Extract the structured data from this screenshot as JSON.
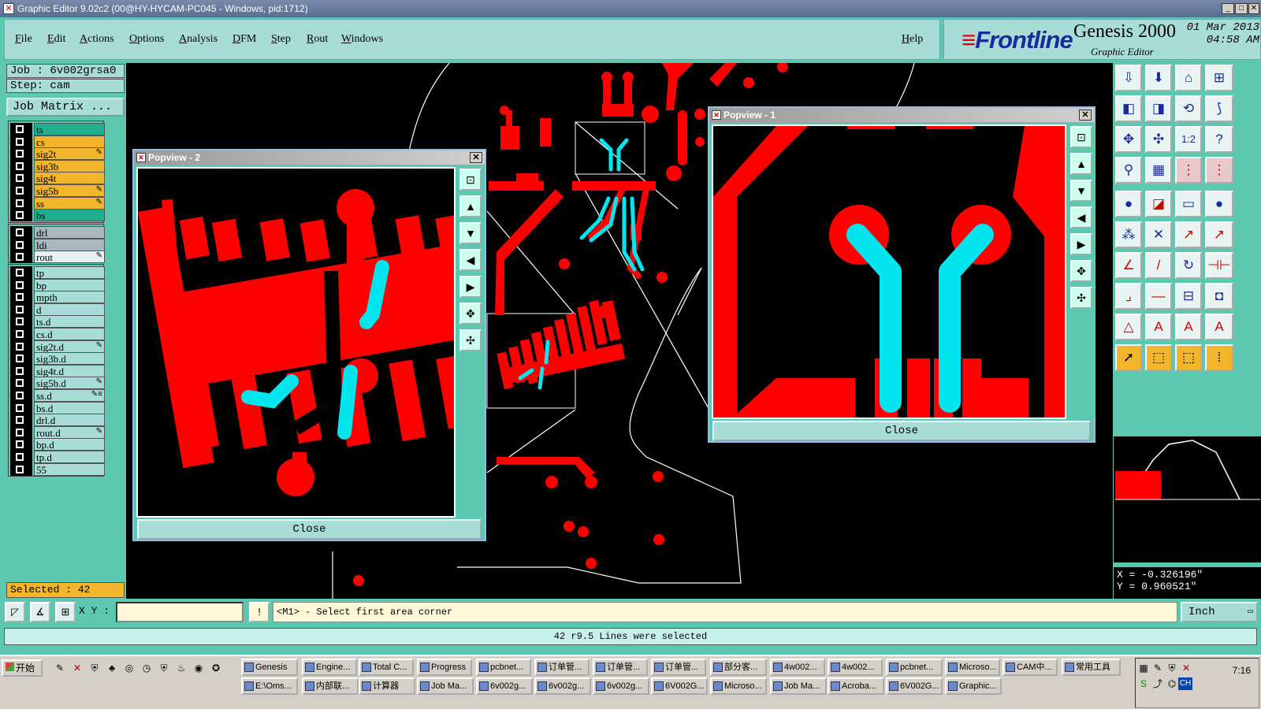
{
  "window": {
    "title": "Graphic Editor 9.02c2 (00@HY-HYCAM-PC045 - Windows, pid:1712)"
  },
  "menu": {
    "items": [
      "File",
      "Edit",
      "Actions",
      "Options",
      "Analysis",
      "DFM",
      "Step",
      "Rout",
      "Windows"
    ],
    "help": "Help"
  },
  "brand": {
    "logo": "Frontline",
    "product": "Genesis 2000",
    "subtitle": "Graphic Editor",
    "date": "01 Mar 2013",
    "time": "04:58 AM"
  },
  "job": {
    "job_label": "Job : 6v002grsa0",
    "step_label": "Step: cam",
    "matrix_button": "Job Matrix ..."
  },
  "layers": {
    "group1": [
      {
        "name": "ts",
        "color": "#1fae8e",
        "edit": ""
      },
      {
        "name": "cs",
        "color": "#f2b62c",
        "edit": ""
      },
      {
        "name": "sig2t",
        "color": "#f2b62c",
        "edit": "✎"
      },
      {
        "name": "sig3b",
        "color": "#f2b62c",
        "edit": ""
      },
      {
        "name": "sig4t",
        "color": "#f2b62c",
        "edit": ""
      },
      {
        "name": "sig5b",
        "color": "#f2b62c",
        "edit": "✎"
      },
      {
        "name": "ss",
        "color": "#f2b62c",
        "edit": "✎"
      },
      {
        "name": "bs",
        "color": "#1fae8e",
        "edit": ""
      }
    ],
    "group2": [
      {
        "name": "drl",
        "color": "#a8b8c0",
        "edit": ""
      },
      {
        "name": "ldi",
        "color": "#a8b8c0",
        "edit": ""
      },
      {
        "name": "rout",
        "color": "#e8f0f0",
        "edit": "✎"
      }
    ],
    "group3": [
      {
        "name": "tp",
        "color": "#a8dcd6",
        "edit": ""
      },
      {
        "name": "bp",
        "color": "#a8dcd6",
        "edit": ""
      },
      {
        "name": "mpth",
        "color": "#a8dcd6",
        "edit": ""
      },
      {
        "name": "d",
        "color": "#a8dcd6",
        "edit": ""
      },
      {
        "name": "ts.d",
        "color": "#a8dcd6",
        "edit": ""
      },
      {
        "name": "cs.d",
        "color": "#a8dcd6",
        "edit": ""
      },
      {
        "name": "sig2t.d",
        "color": "#a8dcd6",
        "edit": "✎"
      },
      {
        "name": "sig3b.d",
        "color": "#a8dcd6",
        "edit": ""
      },
      {
        "name": "sig4t.d",
        "color": "#a8dcd6",
        "edit": ""
      },
      {
        "name": "sig5b.d",
        "color": "#a8dcd6",
        "edit": "✎"
      },
      {
        "name": "ss.d",
        "color": "#a8dcd6",
        "edit": "✎≡"
      },
      {
        "name": "bs.d",
        "color": "#a8dcd6",
        "edit": ""
      },
      {
        "name": "drl.d",
        "color": "#a8dcd6",
        "edit": ""
      },
      {
        "name": "rout.d",
        "color": "#a8dcd6",
        "edit": "✎"
      },
      {
        "name": "bp.d",
        "color": "#a8dcd6",
        "edit": ""
      },
      {
        "name": "tp.d",
        "color": "#a8dcd6",
        "edit": ""
      },
      {
        "name": "55",
        "color": "#a8dcd6",
        "edit": ""
      }
    ]
  },
  "selected": "Selected : 42",
  "popview2": {
    "title": "Popview - 2",
    "close": "Close"
  },
  "popview1": {
    "title": "Popview - 1",
    "close": "Close"
  },
  "coords": {
    "x": "X = -0.326196\"",
    "y": "Y = 0.960521\""
  },
  "command": {
    "xy_label": "X Y :",
    "xy_value": "",
    "prompt": "<M1> - Select first area corner",
    "unit": "Inch"
  },
  "status": "42 r9.5 Lines were selected",
  "taskbar": {
    "start": "开始",
    "row1": [
      "Genesis",
      "Engine...",
      "Total C...",
      "Progress",
      "pcbnet...",
      "订单管...",
      "订单管...",
      "订单管...",
      "部分客...",
      "4w002...",
      "4w002...",
      "pcbnet...",
      "Microso...",
      "CAM中...",
      "常用工具"
    ],
    "row2": [
      "E:\\Oms...",
      "内部联...",
      "计算器",
      "Job Ma...",
      "6v002g...",
      "6v002g...",
      "6v002g...",
      "6V002G...",
      "Microso...",
      "Job Ma...",
      "Acroba...",
      "6V002G...",
      "Graphic..."
    ],
    "clock": "7:16"
  },
  "colors": {
    "copper": "#ff0000",
    "selected": "#00e5ee",
    "panel": "#5cc8b0"
  }
}
